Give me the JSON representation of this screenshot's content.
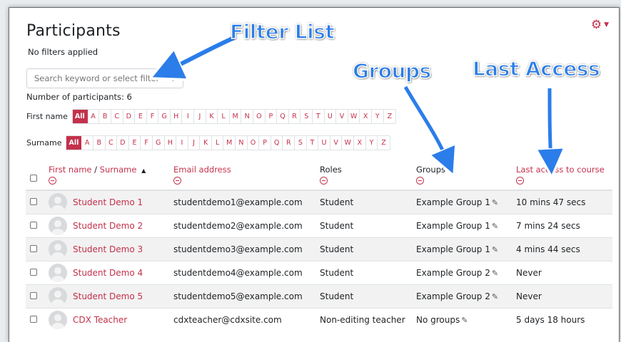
{
  "page": {
    "title": "Participants",
    "subtitle": "No filters applied",
    "search_placeholder": "Search keyword or select filter",
    "participant_count": "Number of participants: 6"
  },
  "filters": {
    "first_name_label": "First name",
    "surname_label": "Surname",
    "first_name_letters": [
      "All",
      "A",
      "B",
      "C",
      "D",
      "E",
      "F",
      "G",
      "H",
      "I",
      "J",
      "K",
      "L",
      "M",
      "N",
      "O",
      "P",
      "Q",
      "R",
      "S",
      "T",
      "U",
      "V",
      "W",
      "X",
      "Y",
      "Z"
    ],
    "surname_letters": [
      "All",
      "A",
      "B",
      "C",
      "D",
      "E",
      "F",
      "G",
      "H",
      "I",
      "J",
      "K",
      "L",
      "M",
      "N",
      "O",
      "P",
      "Q",
      "R",
      "S",
      "T",
      "U",
      "V",
      "W",
      "X",
      "Y",
      "Z"
    ],
    "active_letter": "All"
  },
  "table": {
    "headers": {
      "first_name": "First name",
      "slash": " / ",
      "surname": "Surname",
      "sort_arrow": "▲",
      "email": "Email address",
      "roles": "Roles",
      "groups": "Groups",
      "last_access": "Last access to course"
    },
    "rows": [
      {
        "name": "Student Demo 1",
        "email": "studentdemo1@example.com",
        "role": "Student",
        "group": "Example Group 1",
        "last_access": "10 mins 47 secs"
      },
      {
        "name": "Student Demo 2",
        "email": "studentdemo2@example.com",
        "role": "Student",
        "group": "Example Group 1",
        "last_access": "7 mins 24 secs"
      },
      {
        "name": "Student Demo 3",
        "email": "studentdemo3@example.com",
        "role": "Student",
        "group": "Example Group 1",
        "last_access": "4 mins 44 secs"
      },
      {
        "name": "Student Demo 4",
        "email": "studentdemo4@example.com",
        "role": "Student",
        "group": "Example Group 2",
        "last_access": "Never"
      },
      {
        "name": "Student Demo 5",
        "email": "studentdemo5@example.com",
        "role": "Student",
        "group": "Example Group 2",
        "last_access": "Never"
      },
      {
        "name": "CDX Teacher",
        "email": "cdxteacher@cdxsite.com",
        "role": "Non-editing teacher",
        "group": "No groups",
        "last_access": "5 days 18 hours"
      }
    ]
  },
  "annotations": {
    "filter_list": "Filter List",
    "groups": "Groups",
    "last_access": "Last Access"
  },
  "icons": {
    "gear": "gear-icon",
    "pencil": "pencil-icon",
    "collapse": "minus-circle-icon",
    "avatar": "user-avatar-icon"
  },
  "colors": {
    "accent": "#c4314b",
    "annotation": "#2b7de9"
  }
}
